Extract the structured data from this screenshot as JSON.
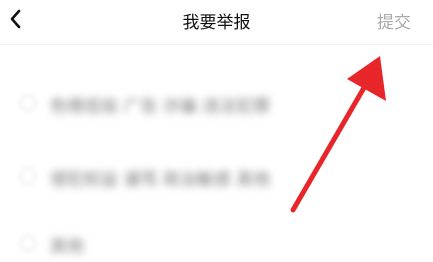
{
  "header": {
    "title": "我要举报",
    "submit_label": "提交",
    "back_icon": "chevron-left-icon"
  },
  "options": [
    {
      "label": "色情低俗 广告 诈骗 违法犯罪"
    },
    {
      "label": "侵犯权益 谩骂 政治敏感 其他"
    },
    {
      "label": "其他"
    }
  ],
  "annotation": {
    "icon": "red-arrow-icon",
    "color": "#e8262a"
  }
}
